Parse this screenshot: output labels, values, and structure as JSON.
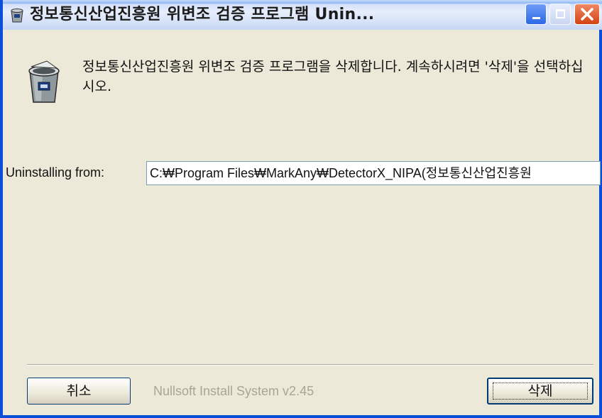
{
  "window": {
    "title": "정보통신산업진흥원 위변조 검증 프로그램 Unin..."
  },
  "header": {
    "message": "정보통신산업진흥원 위변조 검증 프로그램을 삭제합니다. 계속하시려면 '삭제'을 선택하십시오."
  },
  "main": {
    "path_label": "Uninstalling from:",
    "path_value": "C:₩Program Files₩MarkAny₩DetectorX_NIPA(정보통신산업진흥원"
  },
  "footer": {
    "cancel_label": "취소",
    "branding": "Nullsoft Install System v2.45",
    "delete_label": "삭제"
  },
  "icons": {
    "title_icon": "recycle-bin-icon",
    "header_icon": "recycle-bin-icon",
    "minimize": "minimize-icon",
    "maximize": "maximize-icon",
    "close": "close-icon"
  },
  "colors": {
    "window_border": "#0a4fd8",
    "dialog_bg": "#ece9d8",
    "close_button": "#d44213",
    "minimize_button": "#2c69e6"
  }
}
